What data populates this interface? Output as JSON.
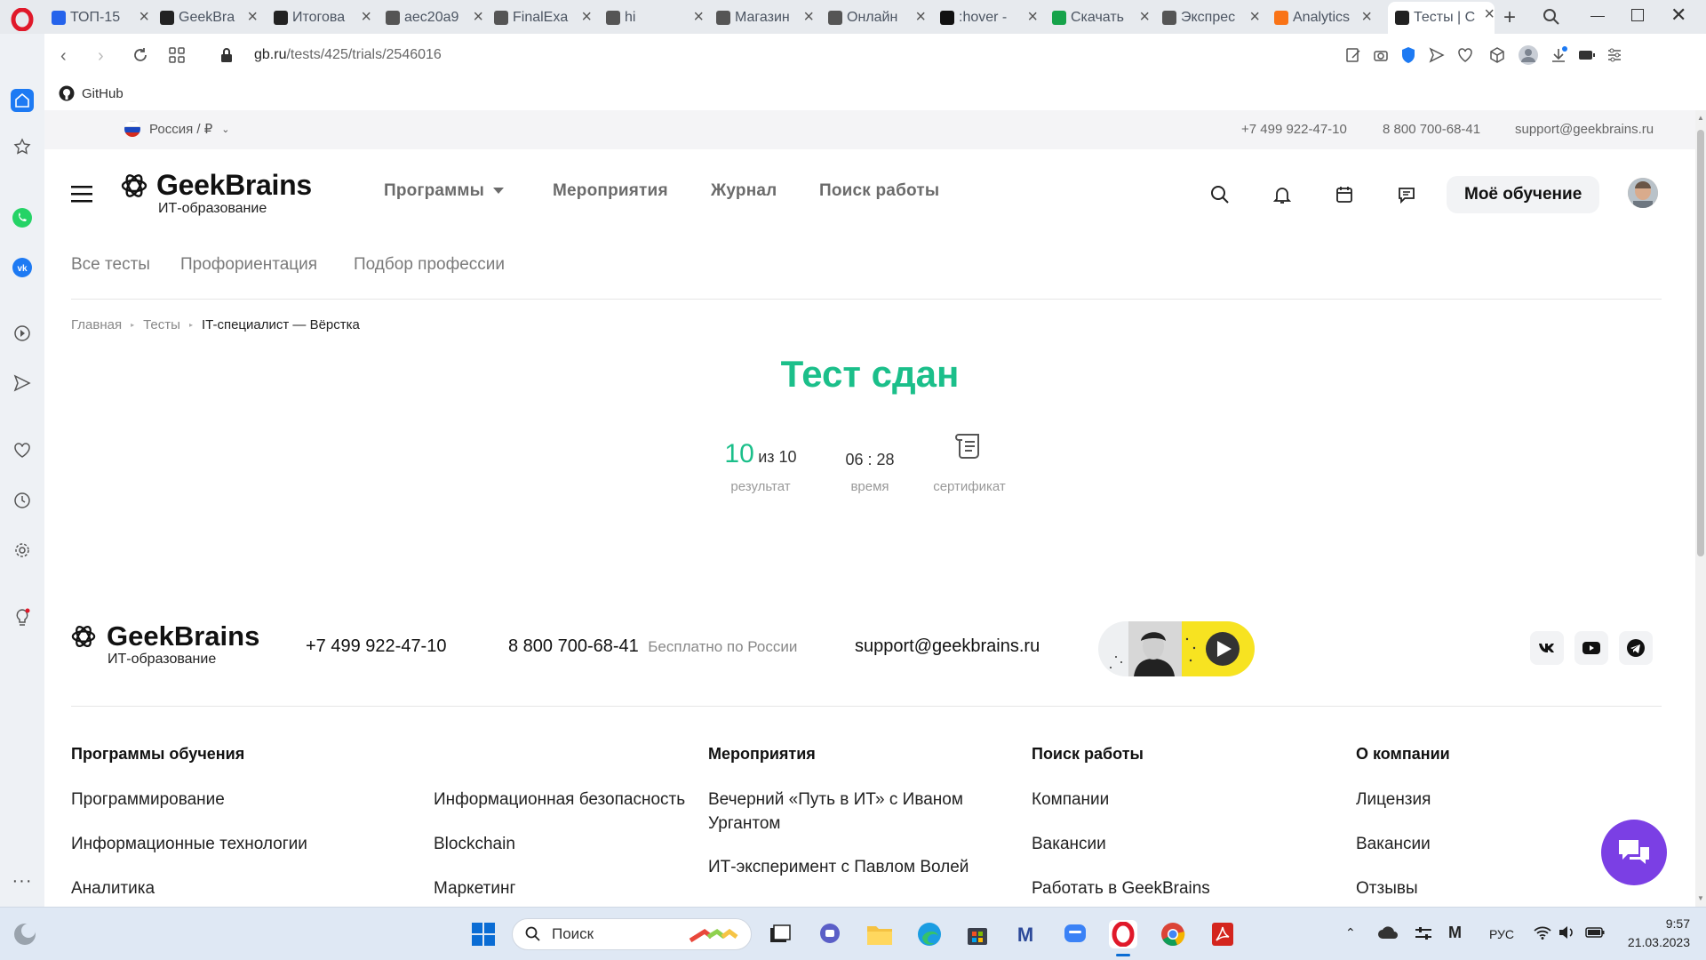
{
  "browser": {
    "tabs": [
      {
        "title": "ТОП-15",
        "color": "#2563eb"
      },
      {
        "title": "GeekBra",
        "color": "#222222"
      },
      {
        "title": "Итогова",
        "color": "#222222"
      },
      {
        "title": "aec20a9",
        "color": "#555555"
      },
      {
        "title": "FinalExa",
        "color": "#555555"
      },
      {
        "title": "hi",
        "color": "#555555"
      },
      {
        "title": "Магазин",
        "color": "#555555"
      },
      {
        "title": "Онлайн",
        "color": "#555555"
      },
      {
        "title": ":hover -",
        "color": "#111111"
      },
      {
        "title": "Скачать",
        "color": "#16a34a"
      },
      {
        "title": "Экспрес",
        "color": "#555555"
      },
      {
        "title": "Analytics",
        "color": "#f97316"
      },
      {
        "title": "Тесты | С",
        "color": "#222222"
      }
    ],
    "url_domain": "gb.ru",
    "url_path": "/tests/425/trials/2546016",
    "bookmark": "GitHub"
  },
  "site": {
    "region": "Россия / ₽",
    "phone1": "+7 499 922-47-10",
    "phone2": "8 800 700-68-41",
    "email": "support@geekbrains.ru",
    "logo_name": "GeekBrains",
    "logo_sub": "ИТ-образование",
    "nav": [
      "Программы",
      "Мероприятия",
      "Журнал",
      "Поиск работы"
    ],
    "my_learning": "Моё обучение",
    "subnav": [
      "Все тесты",
      "Профориентация",
      "Подбор профессии"
    ],
    "breadcrumbs": [
      "Главная",
      "Тесты",
      "IT-специалист — Вёрстка"
    ]
  },
  "result": {
    "title": "Тест сдан",
    "score": "10",
    "score_of": "из 10",
    "score_label": "результат",
    "time": "06 : 28",
    "time_label": "время",
    "cert_label": "сертификат",
    "accent": "#1bbf8a"
  },
  "footer": {
    "phone1": "+7 499 922-47-10",
    "phone2": "8 800 700-68-41",
    "phone2_note": "Бесплатно по России",
    "email": "support@geekbrains.ru",
    "col1_title": "Программы обучения",
    "col1_left": [
      "Программирование",
      "Информационные технологии",
      "Аналитика"
    ],
    "col1_right": [
      "Информационная безопасность",
      "Blockchain",
      "Маркетинг"
    ],
    "col2_title": "Мероприятия",
    "col2": [
      "Вечерний «Путь в ИТ» с Иваном Ургантом",
      "ИТ-эксперимент с Павлом Волей"
    ],
    "col3_title": "Поиск работы",
    "col3": [
      "Компании",
      "Вакансии",
      "Работать в GeekBrains"
    ],
    "col4_title": "О компании",
    "col4": [
      "Лицензия",
      "Вакансии",
      "Отзывы"
    ]
  },
  "taskbar": {
    "search": "Поиск",
    "lang": "РУС",
    "time": "9:57",
    "date": "21.03.2023"
  }
}
